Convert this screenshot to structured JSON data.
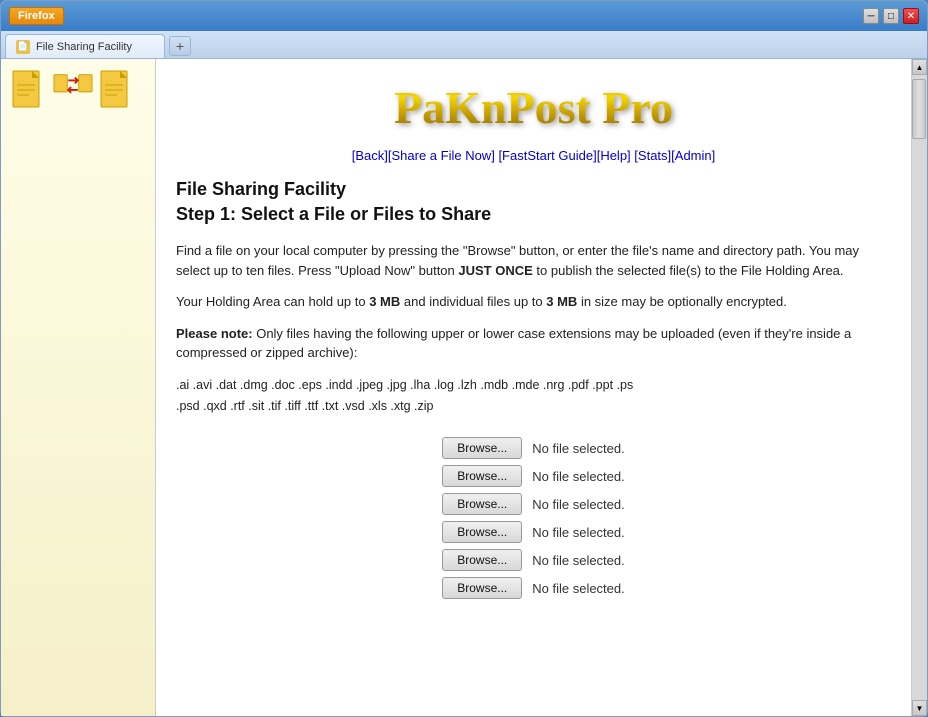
{
  "browser": {
    "title": "Firefox",
    "tab_label": "File Sharing Facility",
    "new_tab_label": "+"
  },
  "titlebar": {
    "minimize": "─",
    "maximize": "□",
    "close": "✕"
  },
  "sidebar_icons": [
    {
      "name": "document-icon-left",
      "type": "file"
    },
    {
      "name": "upload-arrow-icon",
      "type": "arrow"
    },
    {
      "name": "document-icon-right",
      "type": "file"
    }
  ],
  "logo": {
    "text": "PaKnPost Pro"
  },
  "nav": {
    "links": [
      {
        "label": "[Back]",
        "href": "#"
      },
      {
        "label": "[Share a File Now]",
        "href": "#"
      },
      {
        "label": "[FastStart Guide]",
        "href": "#"
      },
      {
        "label": "[Help]",
        "href": "#"
      },
      {
        "label": "[Stats]",
        "href": "#"
      },
      {
        "label": "[Admin]",
        "href": "#"
      }
    ]
  },
  "page": {
    "title": "File Sharing Facility",
    "subtitle": "Step 1: Select a File or Files to Share",
    "description1": "Find a file on your local computer by pressing the \"Browse\" button, or enter the file's name and directory path. You may select up to ten files. Press \"Upload Now\" button ",
    "description1_bold": "JUST ONCE",
    "description1_end": " to publish the selected file(s) to the File Holding Area.",
    "description2_start": "Your Holding Area can hold up to ",
    "description2_bold1": "3 MB",
    "description2_mid": " and individual files up to ",
    "description2_bold2": "3 MB",
    "description2_end": " in size may be optionally encrypted.",
    "note_bold": "Please note:",
    "note_text": " Only files having the following upper or lower case extensions may be uploaded (even if they're inside a compressed or zipped archive):",
    "file_types_line1": ".ai  .avi  .dat  .dmg  .doc  .eps  .indd  .jpeg  .jpg  .lha  .log  .lzh  .mdb  .mde  .nrg  .pdf  .ppt  .ps",
    "file_types_line2": ".psd  .qxd  .rtf  .sit  .tif  .tiff  .ttf  .txt  .vsd  .xls  .xtg  .zip"
  },
  "browse_rows": [
    {
      "button_label": "Browse...",
      "status": "No file selected."
    },
    {
      "button_label": "Browse...",
      "status": "No file selected."
    },
    {
      "button_label": "Browse...",
      "status": "No file selected."
    },
    {
      "button_label": "Browse...",
      "status": "No file selected."
    },
    {
      "button_label": "Browse...",
      "status": "No file selected."
    },
    {
      "button_label": "Browse...",
      "status": "No file selected."
    }
  ]
}
